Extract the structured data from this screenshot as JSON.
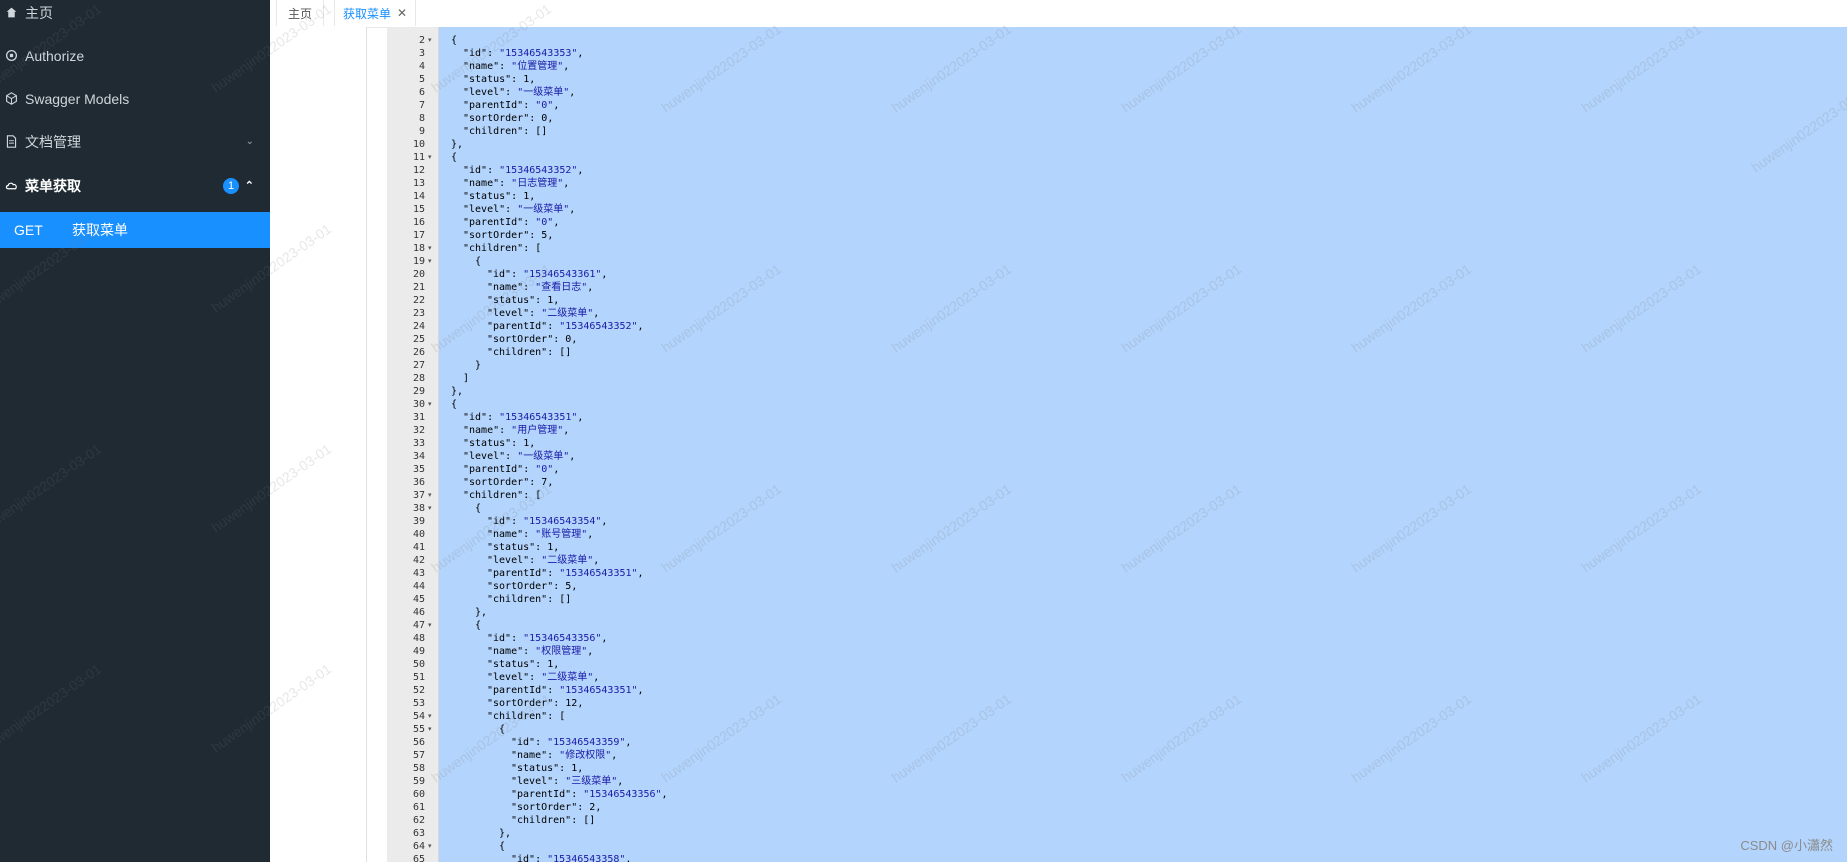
{
  "sidebar": {
    "home": "主页",
    "authorize": "Authorize",
    "models": "Swagger Models",
    "docs": "文档管理",
    "menu_group": "菜单获取",
    "menu_badge": "1",
    "sub_method": "GET",
    "sub_label": "获取菜单"
  },
  "tabs": {
    "home": "主页",
    "active": "获取菜单"
  },
  "watermark": "huwenjin022023-03-01",
  "credit": "CSDN @小瀟然",
  "code_lines": [
    {
      "n": "2",
      "f": "▾",
      "i": 0,
      "t": "{"
    },
    {
      "n": "3",
      "i": 1,
      "k": "\"id\"",
      "v": "\"15346543353\"",
      "e": ","
    },
    {
      "n": "4",
      "i": 1,
      "k": "\"name\"",
      "v": "\"位置管理\"",
      "e": ","
    },
    {
      "n": "5",
      "i": 1,
      "k": "\"status\"",
      "v": "1",
      "e": ","
    },
    {
      "n": "6",
      "i": 1,
      "k": "\"level\"",
      "v": "\"一级菜单\"",
      "e": ","
    },
    {
      "n": "7",
      "i": 1,
      "k": "\"parentId\"",
      "v": "\"0\"",
      "e": ","
    },
    {
      "n": "8",
      "i": 1,
      "k": "\"sortOrder\"",
      "v": "0",
      "e": ","
    },
    {
      "n": "9",
      "i": 1,
      "k": "\"children\"",
      "v": "[]",
      "e": ""
    },
    {
      "n": "10",
      "i": 0,
      "t": "},"
    },
    {
      "n": "11",
      "f": "▾",
      "i": 0,
      "t": "{"
    },
    {
      "n": "12",
      "i": 1,
      "k": "\"id\"",
      "v": "\"15346543352\"",
      "e": ","
    },
    {
      "n": "13",
      "i": 1,
      "k": "\"name\"",
      "v": "\"日志管理\"",
      "e": ","
    },
    {
      "n": "14",
      "i": 1,
      "k": "\"status\"",
      "v": "1",
      "e": ","
    },
    {
      "n": "15",
      "i": 1,
      "k": "\"level\"",
      "v": "\"一级菜单\"",
      "e": ","
    },
    {
      "n": "16",
      "i": 1,
      "k": "\"parentId\"",
      "v": "\"0\"",
      "e": ","
    },
    {
      "n": "17",
      "i": 1,
      "k": "\"sortOrder\"",
      "v": "5",
      "e": ","
    },
    {
      "n": "18",
      "f": "▾",
      "i": 1,
      "k": "\"children\"",
      "v": "[",
      "e": ""
    },
    {
      "n": "19",
      "f": "▾",
      "i": 2,
      "t": "{"
    },
    {
      "n": "20",
      "i": 3,
      "k": "\"id\"",
      "v": "\"15346543361\"",
      "e": ","
    },
    {
      "n": "21",
      "i": 3,
      "k": "\"name\"",
      "v": "\"查看日志\"",
      "e": ","
    },
    {
      "n": "22",
      "i": 3,
      "k": "\"status\"",
      "v": "1",
      "e": ","
    },
    {
      "n": "23",
      "i": 3,
      "k": "\"level\"",
      "v": "\"二级菜单\"",
      "e": ","
    },
    {
      "n": "24",
      "i": 3,
      "k": "\"parentId\"",
      "v": "\"15346543352\"",
      "e": ","
    },
    {
      "n": "25",
      "i": 3,
      "k": "\"sortOrder\"",
      "v": "0",
      "e": ","
    },
    {
      "n": "26",
      "i": 3,
      "k": "\"children\"",
      "v": "[]",
      "e": ""
    },
    {
      "n": "27",
      "i": 2,
      "t": "}"
    },
    {
      "n": "28",
      "i": 1,
      "t": "]"
    },
    {
      "n": "29",
      "i": 0,
      "t": "},"
    },
    {
      "n": "30",
      "f": "▾",
      "i": 0,
      "t": "{"
    },
    {
      "n": "31",
      "i": 1,
      "k": "\"id\"",
      "v": "\"15346543351\"",
      "e": ","
    },
    {
      "n": "32",
      "i": 1,
      "k": "\"name\"",
      "v": "\"用户管理\"",
      "e": ","
    },
    {
      "n": "33",
      "i": 1,
      "k": "\"status\"",
      "v": "1",
      "e": ","
    },
    {
      "n": "34",
      "i": 1,
      "k": "\"level\"",
      "v": "\"一级菜单\"",
      "e": ","
    },
    {
      "n": "35",
      "i": 1,
      "k": "\"parentId\"",
      "v": "\"0\"",
      "e": ","
    },
    {
      "n": "36",
      "i": 1,
      "k": "\"sortOrder\"",
      "v": "7",
      "e": ","
    },
    {
      "n": "37",
      "f": "▾",
      "i": 1,
      "k": "\"children\"",
      "v": "[",
      "e": ""
    },
    {
      "n": "38",
      "f": "▾",
      "i": 2,
      "t": "{"
    },
    {
      "n": "39",
      "i": 3,
      "k": "\"id\"",
      "v": "\"15346543354\"",
      "e": ","
    },
    {
      "n": "40",
      "i": 3,
      "k": "\"name\"",
      "v": "\"账号管理\"",
      "e": ","
    },
    {
      "n": "41",
      "i": 3,
      "k": "\"status\"",
      "v": "1",
      "e": ","
    },
    {
      "n": "42",
      "i": 3,
      "k": "\"level\"",
      "v": "\"二级菜单\"",
      "e": ","
    },
    {
      "n": "43",
      "i": 3,
      "k": "\"parentId\"",
      "v": "\"15346543351\"",
      "e": ","
    },
    {
      "n": "44",
      "i": 3,
      "k": "\"sortOrder\"",
      "v": "5",
      "e": ","
    },
    {
      "n": "45",
      "i": 3,
      "k": "\"children\"",
      "v": "[]",
      "e": ""
    },
    {
      "n": "46",
      "i": 2,
      "t": "},"
    },
    {
      "n": "47",
      "f": "▾",
      "i": 2,
      "t": "{"
    },
    {
      "n": "48",
      "i": 3,
      "k": "\"id\"",
      "v": "\"15346543356\"",
      "e": ","
    },
    {
      "n": "49",
      "i": 3,
      "k": "\"name\"",
      "v": "\"权限管理\"",
      "e": ","
    },
    {
      "n": "50",
      "i": 3,
      "k": "\"status\"",
      "v": "1",
      "e": ","
    },
    {
      "n": "51",
      "i": 3,
      "k": "\"level\"",
      "v": "\"二级菜单\"",
      "e": ","
    },
    {
      "n": "52",
      "i": 3,
      "k": "\"parentId\"",
      "v": "\"15346543351\"",
      "e": ","
    },
    {
      "n": "53",
      "i": 3,
      "k": "\"sortOrder\"",
      "v": "12",
      "e": ","
    },
    {
      "n": "54",
      "f": "▾",
      "i": 3,
      "k": "\"children\"",
      "v": "[",
      "e": ""
    },
    {
      "n": "55",
      "f": "▾",
      "i": 4,
      "t": "{"
    },
    {
      "n": "56",
      "i": 5,
      "k": "\"id\"",
      "v": "\"15346543359\"",
      "e": ","
    },
    {
      "n": "57",
      "i": 5,
      "k": "\"name\"",
      "v": "\"修改权限\"",
      "e": ","
    },
    {
      "n": "58",
      "i": 5,
      "k": "\"status\"",
      "v": "1",
      "e": ","
    },
    {
      "n": "59",
      "i": 5,
      "k": "\"level\"",
      "v": "\"三级菜单\"",
      "e": ","
    },
    {
      "n": "60",
      "i": 5,
      "k": "\"parentId\"",
      "v": "\"15346543356\"",
      "e": ","
    },
    {
      "n": "61",
      "i": 5,
      "k": "\"sortOrder\"",
      "v": "2",
      "e": ","
    },
    {
      "n": "62",
      "i": 5,
      "k": "\"children\"",
      "v": "[]",
      "e": ""
    },
    {
      "n": "63",
      "i": 4,
      "t": "},"
    },
    {
      "n": "64",
      "f": "▾",
      "i": 4,
      "t": "{"
    },
    {
      "n": "65",
      "i": 5,
      "k": "\"id\"",
      "v": "\"15346543358\"",
      "e": ","
    }
  ]
}
